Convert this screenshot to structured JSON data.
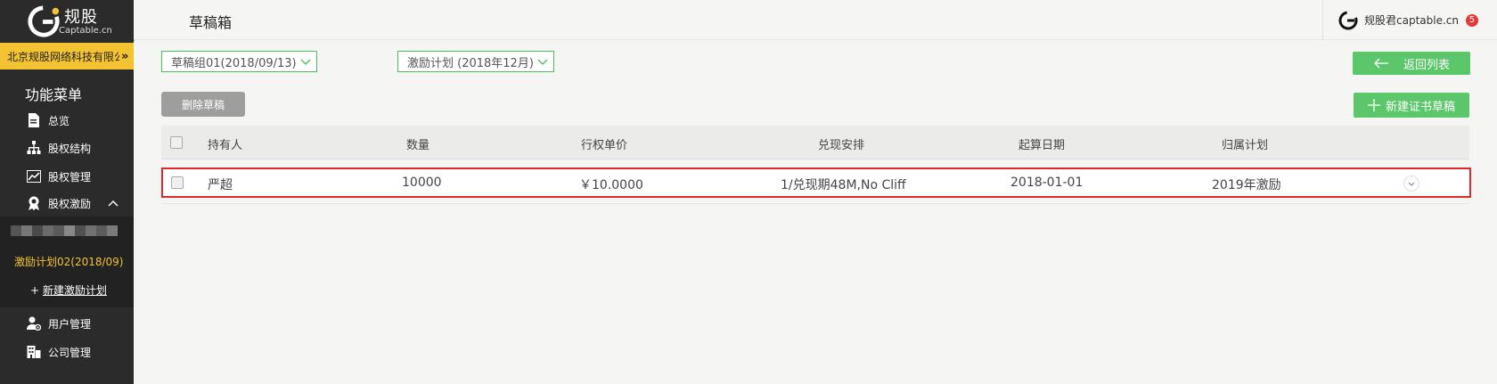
{
  "brand": {
    "name_cn": "规股",
    "name_en": "Captable.cn"
  },
  "sidebar": {
    "company": "北京规股网络科技有限公司",
    "menu_title": "功能菜单",
    "items": [
      {
        "label": "总览",
        "icon": "document-icon"
      },
      {
        "label": "股权结构",
        "icon": "org-chart-icon"
      },
      {
        "label": "股权管理",
        "icon": "trend-chart-icon"
      },
      {
        "label": "股权激励",
        "icon": "award-ribbon-icon"
      },
      {
        "label": "用户管理",
        "icon": "user-gear-icon"
      },
      {
        "label": "公司管理",
        "icon": "company-building-icon"
      }
    ],
    "submenu": {
      "plan": "激励计划02(2018/09)",
      "new_plan_prefix": "+",
      "new_plan": "新建激励计划"
    }
  },
  "header": {
    "title": "草稿箱",
    "user": "规股君captable.cn",
    "notifications": "5"
  },
  "filters": {
    "draft_group": "草稿组01(2018/09/13)",
    "plan": "激励计划 (2018年12月)"
  },
  "actions": {
    "back": "返回列表",
    "delete": "删除草稿",
    "new_cert": "新建证书草稿"
  },
  "table": {
    "columns": [
      "持有人",
      "数量",
      "行权单价",
      "兑现安排",
      "起算日期",
      "归属计划"
    ],
    "rows": [
      {
        "holder": "严超",
        "quantity": "10000",
        "price": "￥10.0000",
        "vesting": "1/兑现期48M,No Cliff",
        "start_date": "2018-01-01",
        "plan": "2019年激励"
      }
    ]
  },
  "colors": {
    "accent_green": "#5cc66a",
    "brand_yellow": "#f4c331",
    "sidebar_dark": "#2b2b2b",
    "highlight_red": "#e0282b"
  }
}
